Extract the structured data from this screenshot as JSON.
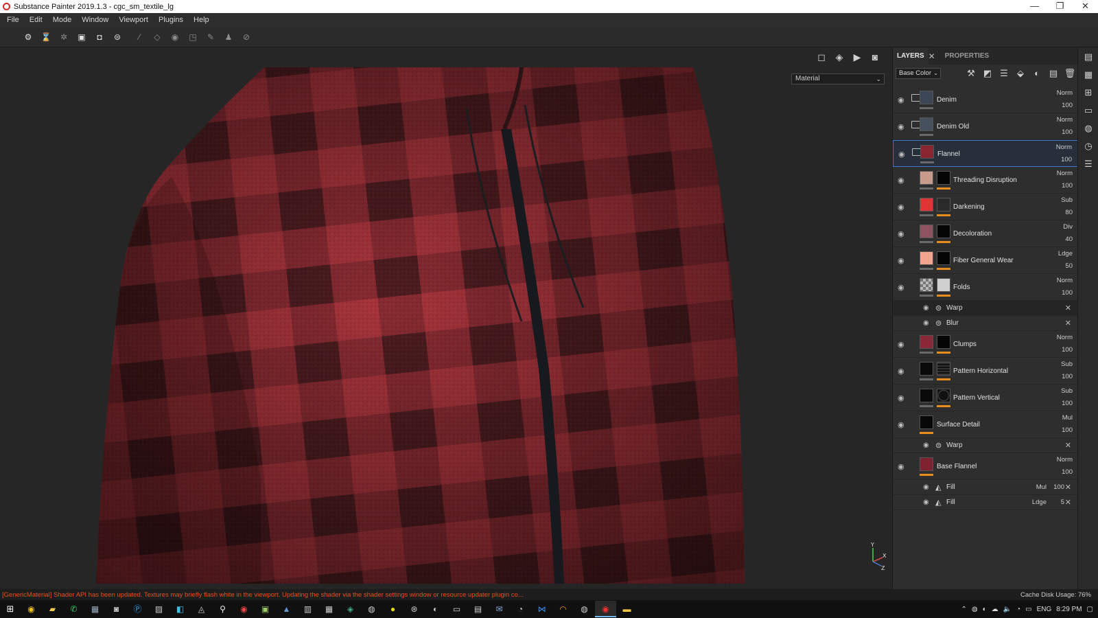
{
  "window": {
    "title": "Substance Painter 2019.1.3 - cgc_sm_textile_lg",
    "controls": [
      "—",
      "❐",
      "✕"
    ]
  },
  "menu": [
    "File",
    "Edit",
    "Mode",
    "Window",
    "Viewport",
    "Plugins",
    "Help"
  ],
  "toolbar": {
    "tools": [
      "brush-icon",
      "eraser-icon",
      "projection-icon",
      "geometry-mask-icon",
      "smudge-icon",
      "clone-icon",
      "color-picker-icon"
    ]
  },
  "viewport": {
    "display_mode": "Material",
    "axis": {
      "y": "Y",
      "x": "X",
      "z": "Z"
    }
  },
  "panel": {
    "tabs": {
      "layers": "LAYERS",
      "properties": "PROPERTIES",
      "close": "✕"
    },
    "channel": "Base Color",
    "layers": [
      {
        "name": "Denim",
        "blend": "Norm",
        "opacity": "100"
      },
      {
        "name": "Denim Old",
        "blend": "Norm",
        "opacity": "100"
      },
      {
        "name": "Flannel",
        "blend": "Norm",
        "opacity": "100"
      },
      {
        "name": "Threading Disruption",
        "blend": "Norm",
        "opacity": "100"
      },
      {
        "name": "Darkening",
        "blend": "Sub",
        "opacity": "80"
      },
      {
        "name": "Decoloration",
        "blend": "Div",
        "opacity": "40"
      },
      {
        "name": "Fiber General Wear",
        "blend": "Ldge",
        "opacity": "50"
      },
      {
        "name": "Folds",
        "blend": "Norm",
        "opacity": "100"
      },
      {
        "name": "Clumps",
        "blend": "Norm",
        "opacity": "100"
      },
      {
        "name": "Pattern Horizontal",
        "blend": "Sub",
        "opacity": "100"
      },
      {
        "name": "Pattern Vertical",
        "blend": "Sub",
        "opacity": "100"
      },
      {
        "name": "Surface Detail",
        "blend": "Mul",
        "opacity": "100"
      },
      {
        "name": "Base Flannel",
        "blend": "Norm",
        "opacity": "100"
      }
    ],
    "effects": {
      "folds_warp": "Warp",
      "folds_blur": "Blur",
      "surface_warp": "Warp",
      "fill1": {
        "name": "Fill",
        "blend": "Mul",
        "opacity": "100"
      },
      "fill2": {
        "name": "Fill",
        "blend": "Ldge",
        "opacity": "5"
      }
    }
  },
  "status": {
    "message": "[GenericMaterial] Shader API has been updated. Textures may briefly flash white in the viewport. Updating the shader via the shader settings window or resource updater plugin co...",
    "cache_label": "Cache Disk Usage:",
    "cache_value": "76%"
  },
  "taskbar": {
    "language": "ENG",
    "time": "8:29 PM"
  },
  "colors": {
    "accent": "#3c7ad6",
    "mask_bar": "#e88c1c",
    "status_error": "#e6521f",
    "flannel_red": "#9b2c33",
    "flannel_dark": "#3d1a1c"
  }
}
